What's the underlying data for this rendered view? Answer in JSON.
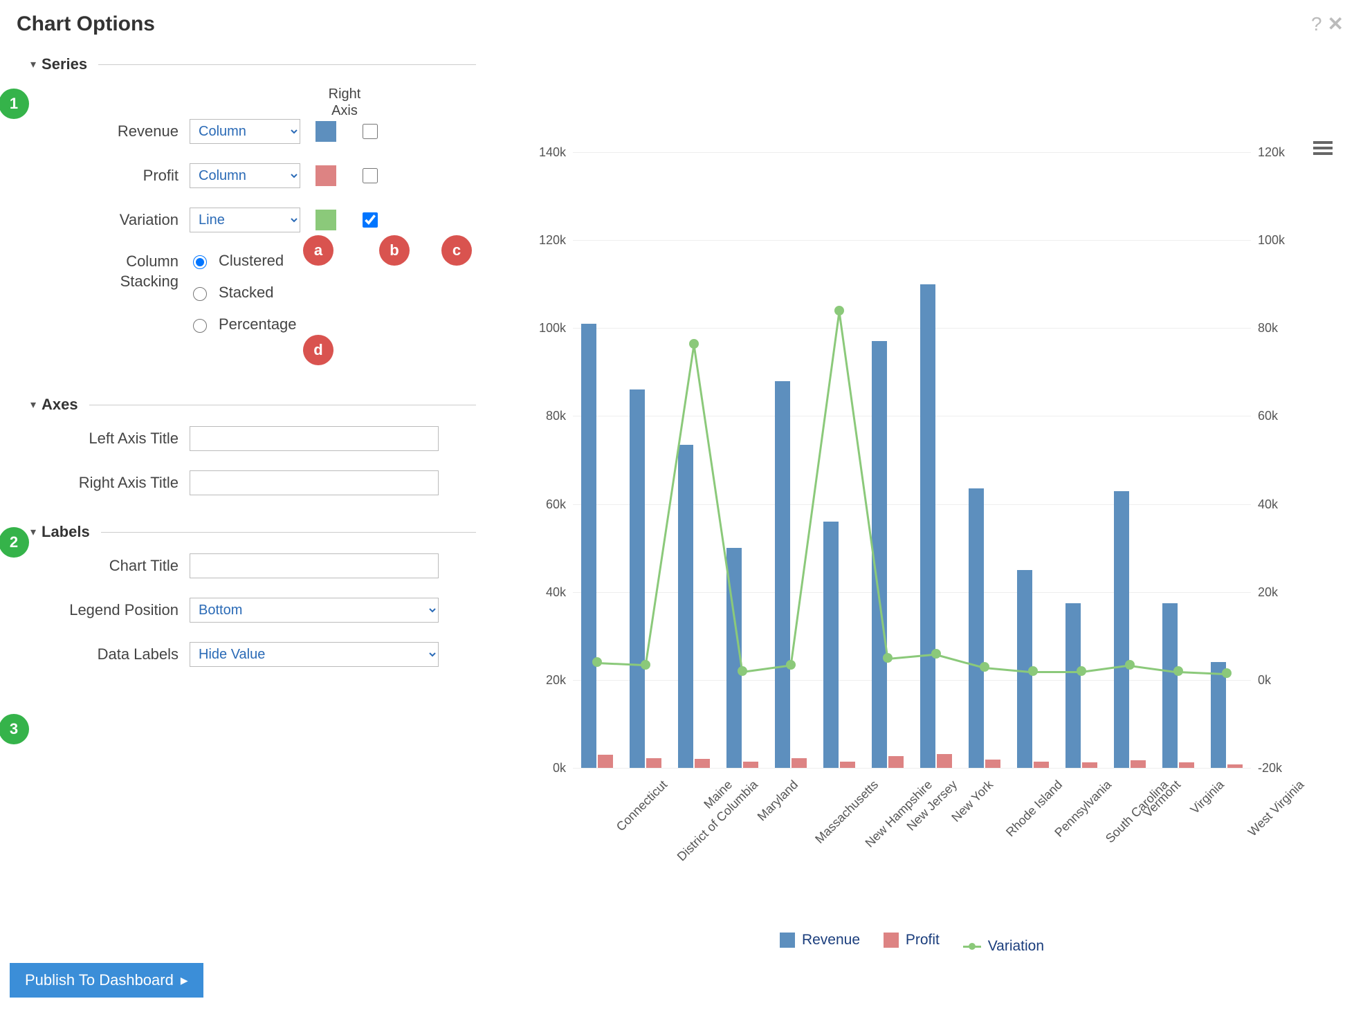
{
  "title": "Chart Options",
  "help_icon": "help-circle-icon",
  "close_icon": "close-icon",
  "burger_icon": "menu-icon",
  "sections": {
    "series": {
      "title": "Series",
      "right_axis_header": "Right\nAxis",
      "rows": [
        {
          "label": "Revenue",
          "type": "Column",
          "color": "#5d8fbe",
          "right_axis": false
        },
        {
          "label": "Profit",
          "type": "Column",
          "color": "#dd8383",
          "right_axis": false
        },
        {
          "label": "Variation",
          "type": "Line",
          "color": "#8bc97a",
          "right_axis": true
        }
      ],
      "stacking": {
        "label": "Column Stacking",
        "options": [
          "Clustered",
          "Stacked",
          "Percentage"
        ],
        "selected": "Clustered"
      }
    },
    "axes": {
      "title": "Axes",
      "left_axis_title_label": "Left Axis Title",
      "left_axis_title_value": "",
      "right_axis_title_label": "Right Axis Title",
      "right_axis_title_value": ""
    },
    "labels": {
      "title": "Labels",
      "chart_title_label": "Chart Title",
      "chart_title_value": "",
      "legend_position_label": "Legend Position",
      "legend_position_value": "Bottom",
      "data_labels_label": "Data Labels",
      "data_labels_value": "Hide Value"
    }
  },
  "annotations": {
    "g1": "1",
    "g2": "2",
    "g3": "3",
    "ra": "a",
    "rb": "b",
    "rc": "c",
    "rd": "d"
  },
  "publish_label": "Publish To Dashboard",
  "legend": {
    "revenue": "Revenue",
    "profit": "Profit",
    "variation": "Variation"
  },
  "chart_data": {
    "type": "bar",
    "categories": [
      "Connecticut",
      "District of Columbia",
      "Maine",
      "Maryland",
      "Massachusetts",
      "New Hampshire",
      "New Jersey",
      "New York",
      "Rhode Island",
      "Pennsylvania",
      "South Carolina",
      "Vermont",
      "Virginia",
      "West Virginia"
    ],
    "series": [
      {
        "name": "Revenue",
        "type": "column",
        "axis": "left",
        "color": "#5d8fbe",
        "values": [
          101000,
          86000,
          73500,
          50000,
          88000,
          56000,
          97000,
          110000,
          63500,
          45000,
          37500,
          63000,
          37500,
          24000
        ]
      },
      {
        "name": "Profit",
        "type": "column",
        "axis": "left",
        "color": "#dd8383",
        "values": [
          3000,
          2200,
          2000,
          1400,
          2200,
          1400,
          2600,
          3200,
          1900,
          1400,
          1200,
          1800,
          1200,
          800
        ]
      },
      {
        "name": "Variation",
        "type": "line",
        "axis": "right",
        "color": "#8bc97a",
        "values": [
          4000,
          3500,
          76500,
          2000,
          3500,
          84000,
          5000,
          6000,
          3000,
          2000,
          2000,
          3500,
          2000,
          1500
        ]
      }
    ],
    "left_axis": {
      "ticks": [
        0,
        20,
        40,
        60,
        80,
        100,
        120,
        140
      ],
      "suffix": "k",
      "ylim": [
        0,
        140000
      ]
    },
    "right_axis": {
      "ticks": [
        -20,
        0,
        20,
        40,
        60,
        80,
        100,
        120
      ],
      "suffix": "k",
      "ylim": [
        -20000,
        120000
      ]
    },
    "xlabel": "",
    "legend_position": "bottom"
  }
}
